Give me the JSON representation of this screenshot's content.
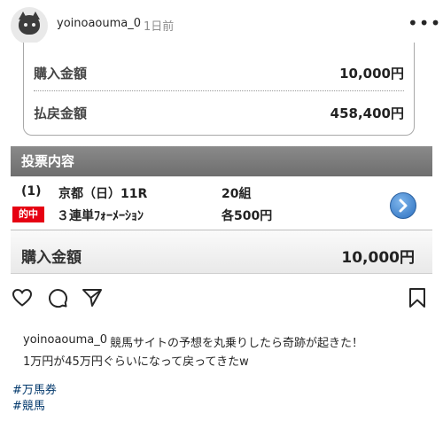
{
  "post": {
    "username": "yoinoaouma_0",
    "time_ago": "1日前"
  },
  "image": {
    "top_card": {
      "purchase_label": "購入金額",
      "purchase_value": "10,000円",
      "refund_label": "払戻金額",
      "refund_value": "458,400円"
    },
    "section_title": "投票内容",
    "bet": {
      "number": "(1)",
      "race": "京都（日）11R",
      "combos": "20組",
      "hit_badge": "的中",
      "bet_type": "３連単ﾌｫｰﾒｰｼｮﾝ",
      "each_amount": "各500円"
    },
    "total": {
      "label": "購入金額",
      "value": "10,000円"
    }
  },
  "actions": {
    "like": "heart-icon",
    "comment": "comment-icon",
    "share": "share-icon",
    "save": "bookmark-icon"
  },
  "caption": {
    "username": "yoinoaouma_0",
    "line1": "競馬サイトの予想を丸乗りしたら奇跡が起きた！",
    "line2": "1万円が45万円ぐらいになって戻ってきたw",
    "hashtags": [
      "#万馬券",
      "#競馬"
    ]
  }
}
